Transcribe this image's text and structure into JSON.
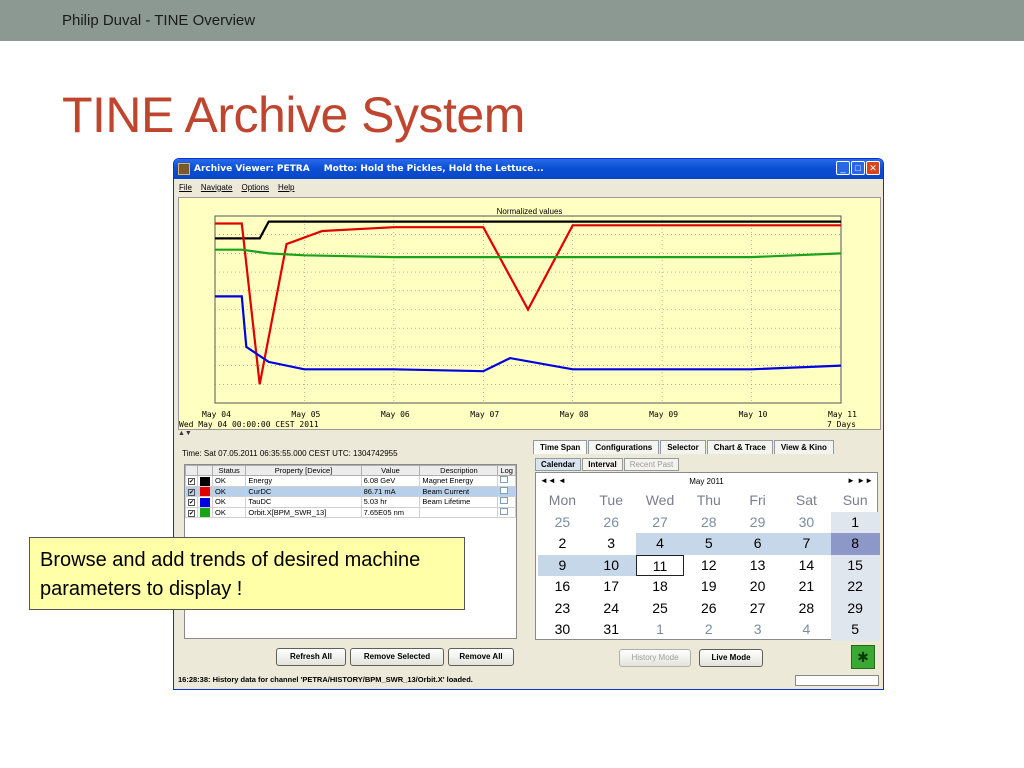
{
  "slide": {
    "header": "Philip Duval - TINE Overview",
    "title": "TINE Archive System",
    "callout": "Browse and add trends of desired machine parameters to display !"
  },
  "window": {
    "title": "Archive Viewer: PETRA",
    "motto": "Motto: Hold the Pickles, Hold the Lettuce...",
    "buttons": [
      "_",
      "□",
      "✕"
    ],
    "menu": [
      "File",
      "Navigate",
      "Options",
      "Help"
    ]
  },
  "chart_data": {
    "type": "line",
    "title": "Normalized values",
    "x_ticks": [
      "May 04",
      "May 05",
      "May 06",
      "May 07",
      "May 08",
      "May 09",
      "May 10",
      "May 11"
    ],
    "x_start_label": "Wed May 04 00:00:00 CEST 2011",
    "x_span_label": "7 Days",
    "grid": true,
    "series": [
      {
        "color": "#000000",
        "x": [
          0,
          0.5,
          0.6,
          7
        ],
        "y": [
          0.88,
          0.88,
          0.97,
          0.97
        ]
      },
      {
        "color": "#e00000",
        "x": [
          0,
          0.3,
          0.5,
          0.8,
          1.2,
          2.0,
          3.0,
          3.5,
          4.0,
          5.0,
          6.0,
          7.0
        ],
        "y": [
          0.96,
          0.96,
          0.1,
          0.85,
          0.92,
          0.94,
          0.94,
          0.5,
          0.95,
          0.95,
          0.95,
          0.95
        ]
      },
      {
        "color": "#19a319",
        "x": [
          0,
          0.3,
          0.6,
          1.0,
          2.0,
          3.0,
          4.0,
          5.0,
          6.0,
          7.0
        ],
        "y": [
          0.82,
          0.82,
          0.8,
          0.79,
          0.78,
          0.78,
          0.78,
          0.78,
          0.78,
          0.8
        ]
      },
      {
        "color": "#0000e0",
        "x": [
          0,
          0.3,
          0.35,
          0.6,
          1.0,
          2.0,
          3.0,
          3.3,
          4.0,
          5.0,
          6.0,
          7.0
        ],
        "y": [
          0.57,
          0.57,
          0.3,
          0.22,
          0.18,
          0.18,
          0.17,
          0.24,
          0.18,
          0.18,
          0.18,
          0.2
        ]
      }
    ],
    "xlim": [
      0,
      7
    ],
    "ylim": [
      0,
      1
    ]
  },
  "left": {
    "time_label": "Time: Sat 07.05.2011 06:35:55.000 CEST    UTC: 1304742955",
    "columns": [
      "",
      "",
      "Status",
      "Property [Device]",
      "Value",
      "Description",
      "Log"
    ],
    "rows": [
      {
        "check": "✔",
        "color": "#000000",
        "status": "OK",
        "property": "Energy",
        "value": "6.08 GeV",
        "description": "Magnet Energy"
      },
      {
        "check": "✔",
        "color": "#e00000",
        "status": "OK",
        "property": "CurDC",
        "value": "86.71 mA",
        "description": "Beam Current"
      },
      {
        "check": "✔",
        "color": "#0000e0",
        "status": "OK",
        "property": "TauDC",
        "value": "5.03 hr",
        "description": "Beam Lifetime"
      },
      {
        "check": "✔",
        "color": "#19a319",
        "status": "OK",
        "property": "Orbit.X[BPM_SWR_13]",
        "value": "7.65E05 nm",
        "description": ""
      }
    ],
    "buttons": {
      "refresh": "Refresh All",
      "remove_selected": "Remove Selected",
      "remove_all": "Remove All"
    }
  },
  "right": {
    "tabs": [
      "Time Span",
      "Configurations",
      "Selector",
      "Chart & Trace",
      "View & Kino"
    ],
    "subtabs": [
      "Calendar",
      "Interval",
      "Recent Past"
    ],
    "calendar": {
      "month": "May 2011",
      "nav_prev": "◄◄  ◄",
      "nav_next": "►  ►►",
      "weekdays": [
        "Mon",
        "Tue",
        "Wed",
        "Thu",
        "Fri",
        "Sat",
        "Sun"
      ],
      "days": [
        [
          "25",
          "26",
          "27",
          "28",
          "29",
          "30",
          "1"
        ],
        [
          "2",
          "3",
          "4",
          "5",
          "6",
          "7",
          "8"
        ],
        [
          "9",
          "10",
          "11",
          "12",
          "13",
          "14",
          "15"
        ],
        [
          "16",
          "17",
          "18",
          "19",
          "20",
          "21",
          "22"
        ],
        [
          "23",
          "24",
          "25",
          "26",
          "27",
          "28",
          "29"
        ],
        [
          "30",
          "31",
          "1",
          "2",
          "3",
          "4",
          "5"
        ]
      ]
    },
    "buttons": {
      "history": "History Mode",
      "live": "Live Mode"
    }
  },
  "status": "16:28:38: History data for channel 'PETRA/HISTORY/BPM_SWR_13/Orbit.X' loaded."
}
